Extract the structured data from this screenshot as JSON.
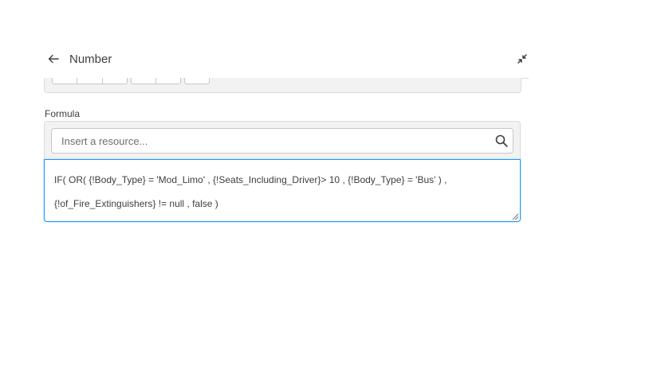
{
  "header": {
    "title": "Number",
    "back_icon": "arrow-left-icon",
    "collapse_icon": "collapse-arrows-icon"
  },
  "formula": {
    "label": "Formula",
    "resource_placeholder": "Insert a resource...",
    "search_icon": "search-icon",
    "line1": "IF( OR( {!Body_Type} = 'Mod_Limo' , {!Seats_Including_Driver}> 10 , {!Body_Type} = 'Bus' ) ,",
    "line2": "{!of_Fire_Extinguishers} != null , false )"
  },
  "colors": {
    "focus_border": "#1b96ff",
    "panel_bg": "#f3f2f2",
    "border": "#dddbda"
  }
}
